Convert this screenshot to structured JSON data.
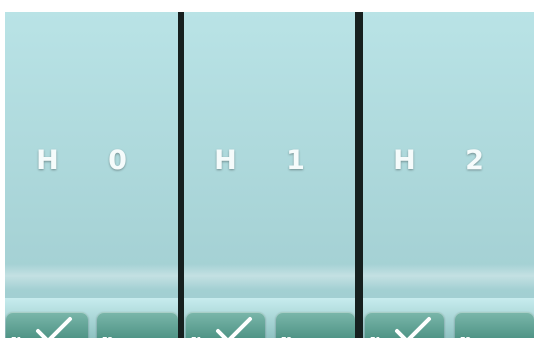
{
  "screens": [
    {
      "display": "H 0",
      "buttons": [
        {
          "key": "F1",
          "icon": "check-icon"
        },
        {
          "key": "F2",
          "icon": null
        }
      ]
    },
    {
      "display": "H 1",
      "buttons": [
        {
          "key": "F1",
          "icon": "check-icon"
        },
        {
          "key": "F2",
          "icon": null
        }
      ]
    },
    {
      "display": "H 2",
      "buttons": [
        {
          "key": "F1",
          "icon": "check-icon"
        },
        {
          "key": "F2",
          "icon": null
        }
      ]
    }
  ],
  "colors": {
    "screen_top": "#b9e3e6",
    "screen_bottom": "#a2cfd2",
    "button": "#5e9e91",
    "divider": "#16201f",
    "text": "#f5fbfb"
  }
}
